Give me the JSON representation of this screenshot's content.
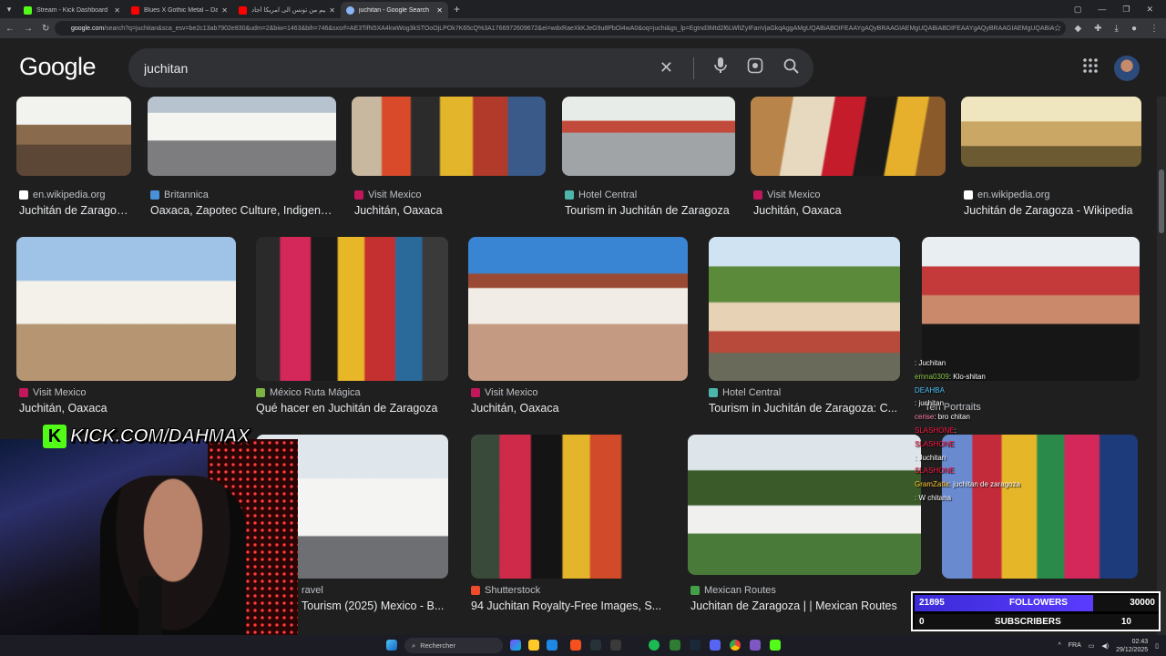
{
  "browser": {
    "tabs": [
      {
        "title": "Stream - Kick Dashboard",
        "color": "#53fc18"
      },
      {
        "title": "Blues X Gothic Metal – Dark Ele",
        "color": "#ff0000"
      },
      {
        "title": "الجحيم من تونس الى امريكا أجاد",
        "color": "#ff0000"
      },
      {
        "title": "juchitan - Google Search",
        "color": "#8ab4f8"
      }
    ],
    "url_host": "google.com",
    "url_rest": "/search?q=juchitan&sca_esv=be2c13ab7902e830&udm=2&biw=1463&bih=746&sxsrf=AE3TifN5XA4kwWog3kSTOoOjLPOk7K65cQ%3A1766972609672&ei=wdxRaeXkKJeG9u8PbOi4wA0&oq=juchi&gs_lp=Egtnd3Mtd2l6LWltZyIFanVjaGkqAggAMgUQABiABDIFEAAYgAQyBRAAGIAEMgUQABiABDIFEAAYgAQyBRAAGIAEMgUQABiA"
  },
  "search": {
    "query": "juchitan",
    "logo": "Google"
  },
  "results": [
    {
      "source": "en.wikipedia.org",
      "title": "Juchitán de Zaragoza - Wikipedia",
      "icon_color": "#ffffff"
    },
    {
      "source": "Britannica",
      "title": "Oaxaca, Zapotec Culture, Indigenous...",
      "icon_color": "#4a90d9"
    },
    {
      "source": "Visit Mexico",
      "title": "Juchitán, Oaxaca",
      "icon_color": "#c2185b"
    },
    {
      "source": "Hotel Central",
      "title": "Tourism in Juchitán de Zaragoza",
      "icon_color": "#4db6ac"
    },
    {
      "source": "Visit Mexico",
      "title": "Juchitán, Oaxaca",
      "icon_color": "#c2185b"
    },
    {
      "source": "en.wikipedia.org",
      "title": "Juchitán de Zaragoza - Wikipedia",
      "icon_color": "#ffffff"
    },
    {
      "source": "Visit Mexico",
      "title": "Juchitán, Oaxaca",
      "icon_color": "#c2185b"
    },
    {
      "source": "México Ruta Mágica",
      "title": "Qué hacer en Juchitán de Zaragoza",
      "icon_color": "#7cb342"
    },
    {
      "source": "Visit Mexico",
      "title": "Juchitán, Oaxaca",
      "icon_color": "#c2185b"
    },
    {
      "source": "Hotel Central",
      "title": "Tourism in Juchitán de Zaragoza: C...",
      "icon_color": "#4db6ac"
    },
    {
      "source": "Ten Portraits",
      "title": "",
      "icon_color": "#9e9e9e"
    },
    {
      "source": "ravel",
      "title": "Tourism (2025) Mexico - B...",
      "icon_color": "#f4511e"
    },
    {
      "source": "Shutterstock",
      "title": "94 Juchitan Royalty-Free Images, S...",
      "icon_color": "#ee4b2b"
    },
    {
      "source": "Mexican Routes",
      "title": "Juchitan de Zaragoza | | Mexican Routes",
      "icon_color": "#43a047"
    }
  ],
  "stream": {
    "kick_label": "KICK.COM/DAHMAX",
    "chat": [
      {
        "user": "",
        "msg": ": Juchitan",
        "color": "#e53935"
      },
      {
        "user": "emna0309",
        "msg": ": Klo-shitan",
        "color": "#8bc34a"
      },
      {
        "user": "DEAHBA",
        "msg": "",
        "color": "#4fc3f7"
      },
      {
        "user": "",
        "msg": ": juchitan",
        "color": "#e91e63"
      },
      {
        "user": "cerise",
        "msg": ": bro chitan",
        "color": "#ff80ab"
      },
      {
        "user": "SLASHONE",
        "msg": ":",
        "color": "#ff1744"
      },
      {
        "user": "SLASHONE",
        "msg": "",
        "color": "#ff1744"
      },
      {
        "user": "",
        "msg": ": Juchitan",
        "color": "#ff5252"
      },
      {
        "user": "SLASHONE",
        "msg": "",
        "color": "#ff1744"
      },
      {
        "user": "GramZatla",
        "msg": ": juchitan de zaragoza",
        "color": "#ffca28"
      },
      {
        "user": "",
        "msg": ": W chitana",
        "color": "#64b5f6"
      }
    ],
    "followers": {
      "current": "21895",
      "label": "FOLLOWERS",
      "goal": "30000",
      "progress": 0.73
    },
    "subscribers": {
      "current": "0",
      "label": "SUBSCRIBERS",
      "goal": "10",
      "progress": 0
    }
  },
  "taskbar": {
    "search_label": "Rechercher",
    "language": "FRA",
    "time": "02:43",
    "date": "29/12/2025"
  }
}
